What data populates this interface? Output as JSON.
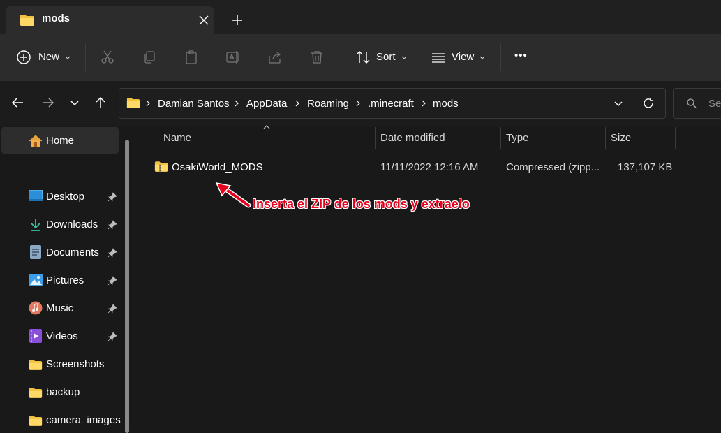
{
  "window": {
    "tab_title": "mods",
    "new_tab_symbol": "+"
  },
  "toolbar": {
    "new_label": "New",
    "sort_label": "Sort",
    "view_label": "View",
    "more_label": "•••"
  },
  "address": {
    "crumbs": [
      "Damian Santos",
      "AppData",
      "Roaming",
      ".minecraft",
      "mods"
    ]
  },
  "search": {
    "placeholder": "Sea"
  },
  "sidebar": {
    "home_label": "Home",
    "items": [
      {
        "label": "Desktop",
        "icon": "desktop-icon",
        "pinned": true
      },
      {
        "label": "Downloads",
        "icon": "downloads-icon",
        "pinned": true
      },
      {
        "label": "Documents",
        "icon": "documents-icon",
        "pinned": true
      },
      {
        "label": "Pictures",
        "icon": "pictures-icon",
        "pinned": true
      },
      {
        "label": "Music",
        "icon": "music-icon",
        "pinned": true
      },
      {
        "label": "Videos",
        "icon": "videos-icon",
        "pinned": true
      },
      {
        "label": "Screenshots",
        "icon": "folder-icon",
        "pinned": false
      },
      {
        "label": "backup",
        "icon": "folder-icon",
        "pinned": false
      },
      {
        "label": "camera_images",
        "icon": "folder-icon",
        "pinned": false
      }
    ]
  },
  "columns": {
    "name": "Name",
    "date": "Date modified",
    "type": "Type",
    "size": "Size"
  },
  "files": [
    {
      "name": "OsakiWorld_MODS",
      "date": "11/11/2022 12:16 AM",
      "type": "Compressed (zipp...",
      "size": "137,107 KB"
    }
  ],
  "annotation": {
    "text": "Inserta el ZIP de los mods y extraelo",
    "color": "#e8001e"
  },
  "colors": {
    "folder_yellow": "#f0c040",
    "accent": "#4cc2ff"
  }
}
